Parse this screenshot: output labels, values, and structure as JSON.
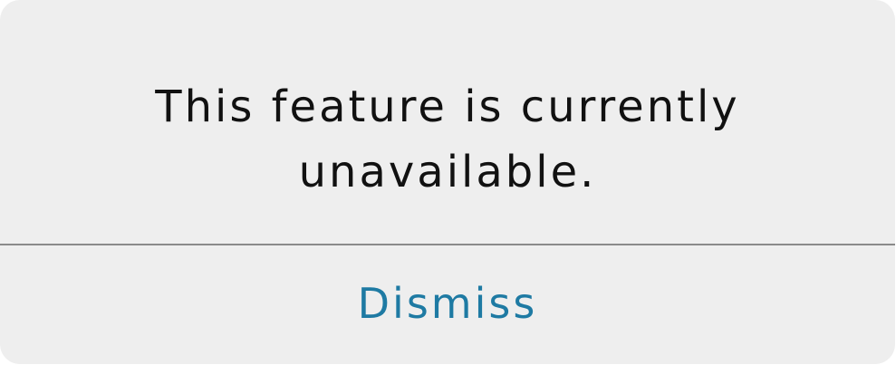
{
  "dialog": {
    "message": "This feature is currently unavailable.",
    "dismiss_label": "Dismiss"
  },
  "colors": {
    "background": "#eeeeee",
    "text": "#111111",
    "accent": "#1e7aa3",
    "divider": "#8a8a8a"
  }
}
